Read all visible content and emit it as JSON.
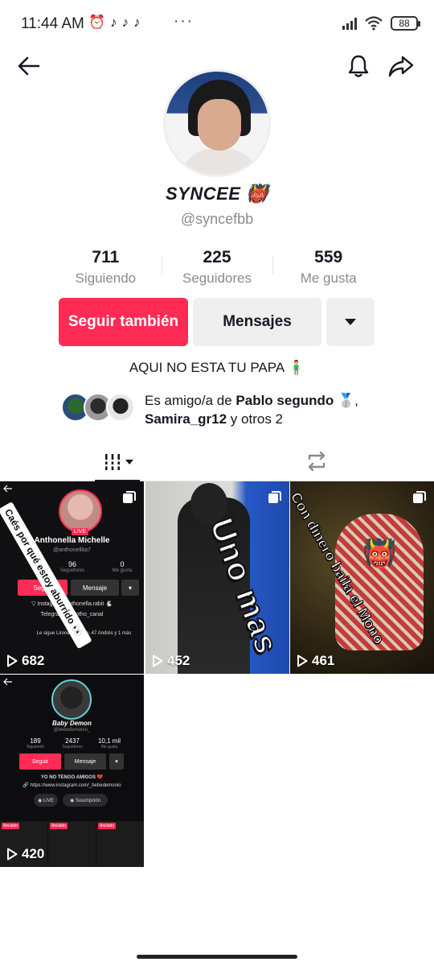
{
  "status_bar": {
    "time": "11:44 AM",
    "battery": "88",
    "left_icons": [
      "alarm-icon",
      "tiktok-icon",
      "tiktok-icon",
      "tiktok-icon"
    ],
    "more": "···"
  },
  "profile": {
    "display_name": "SYNCEE 👹",
    "handle": "@syncefbb",
    "stats": [
      {
        "value": "711",
        "label": "Siguiendo"
      },
      {
        "value": "225",
        "label": "Seguidores"
      },
      {
        "value": "559",
        "label": "Me gusta"
      }
    ],
    "follow_label": "Seguir también",
    "message_label": "Mensajes",
    "bio": "AQUI NO ESTA TU PAPA 🧍‍♂️",
    "friends": {
      "prefix": "Es amigo/a de ",
      "name1": "Pablo segundo 🥈",
      "sep": ",",
      "name2": "Samira_gr12",
      "suffix": " y otros 2"
    }
  },
  "videos": [
    {
      "views": "682",
      "caption": "Caés por qué estoy aburrido 👀",
      "inner": {
        "name": "Anthonella Michelle",
        "handle": "@anthonellita7",
        "stat1": "96",
        "stat1_lbl": "Seguidores",
        "stat2": "0",
        "stat2_lbl": "Me gusta",
        "btn1": "Seguir",
        "btn2": "Mensaje",
        "live": "LIVE",
        "line1": "▽ Instagram: anthonella.rabit 🐇",
        "line2": "Telegram: @_otho_canal",
        "line3": "Le sigue Lirone Bandido, 47 Andrés y 1 más"
      }
    },
    {
      "views": "452",
      "caption": "Uno mas"
    },
    {
      "views": "461",
      "caption": "Con dinero baila el Mono",
      "emoji": "👹"
    },
    {
      "views": "420",
      "inner": {
        "name": "Baby Demon",
        "handle": "@bebedemonio_",
        "stat1": "189",
        "stat1_lbl": "Siguiendo",
        "stat2": "2437",
        "stat2_lbl": "Seguidores",
        "stat3": "10,1 mil",
        "stat3_lbl": "Me gusta",
        "btn1": "Seguir",
        "btn2": "Mensaje",
        "line1": "YO NO TENGO AMIGOS 💔",
        "line2": "🔗 https://www.instagram.com/_bebedemonio",
        "pill1": "◉ LIVE",
        "pill2": "◉ Suscripción",
        "pinned": "Anclado"
      }
    }
  ],
  "colors": {
    "accent": "#fe2c55",
    "text": "#161823",
    "muted": "#8a8b91",
    "button_bg": "#efefef"
  }
}
